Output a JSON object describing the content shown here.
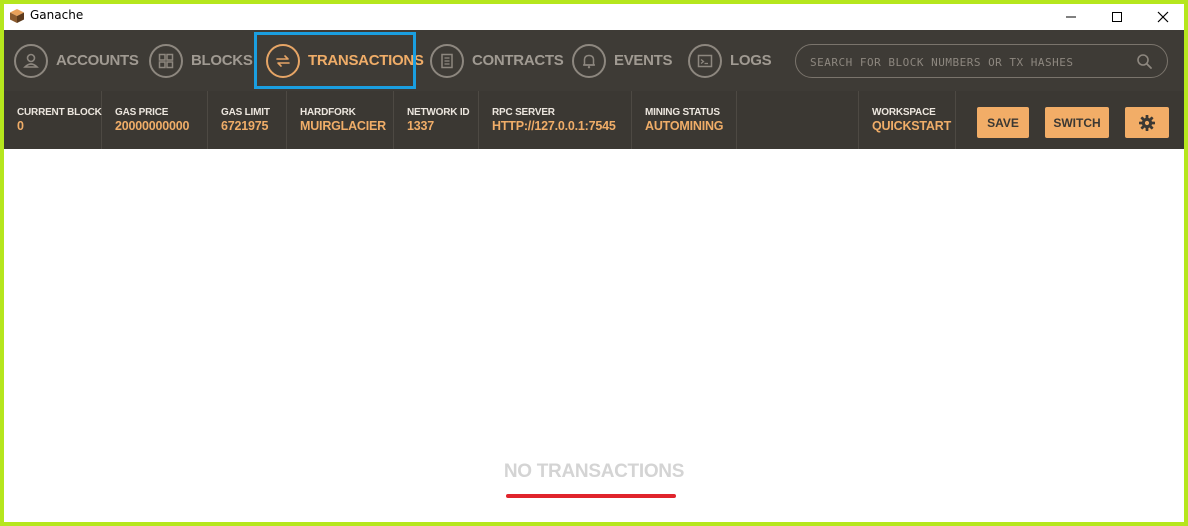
{
  "window": {
    "title": "Ganache"
  },
  "nav": {
    "items": [
      {
        "label": "ACCOUNTS",
        "icon": "account-icon"
      },
      {
        "label": "BLOCKS",
        "icon": "blocks-icon"
      },
      {
        "label": "TRANSACTIONS",
        "icon": "transactions-icon",
        "active": true
      },
      {
        "label": "CONTRACTS",
        "icon": "contracts-icon"
      },
      {
        "label": "EVENTS",
        "icon": "bell-icon"
      },
      {
        "label": "LOGS",
        "icon": "terminal-icon"
      }
    ],
    "search_placeholder": "SEARCH FOR BLOCK NUMBERS OR TX HASHES",
    "search_value": ""
  },
  "status": {
    "current_block": {
      "label": "CURRENT BLOCK",
      "value": "0"
    },
    "gas_price": {
      "label": "GAS PRICE",
      "value": "20000000000"
    },
    "gas_limit": {
      "label": "GAS LIMIT",
      "value": "6721975"
    },
    "hardfork": {
      "label": "HARDFORK",
      "value": "MUIRGLACIER"
    },
    "network_id": {
      "label": "NETWORK ID",
      "value": "1337"
    },
    "rpc_server": {
      "label": "RPC SERVER",
      "value": "HTTP://127.0.0.1:7545"
    },
    "mining_status": {
      "label": "MINING STATUS",
      "value": "AUTOMINING"
    },
    "workspace": {
      "label": "WORKSPACE",
      "value": "QUICKSTART"
    }
  },
  "buttons": {
    "save": "SAVE",
    "switch": "SWITCH"
  },
  "content": {
    "empty_message": "NO TRANSACTIONS"
  },
  "colors": {
    "nav_bg": "#3e3b36",
    "accent": "#f0ad68",
    "highlight_box": "#1a9ee0",
    "underline": "#e0242c",
    "window_border": "#b5e61d"
  }
}
